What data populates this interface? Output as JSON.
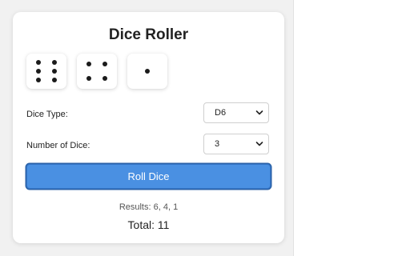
{
  "app": {
    "title": "Dice Roller"
  },
  "dice": [
    {
      "value": 6
    },
    {
      "value": 4
    },
    {
      "value": 1
    }
  ],
  "settings": {
    "dice_type_label": "Dice Type:",
    "dice_type_value": "D6",
    "number_of_dice_label": "Number of Dice:",
    "number_of_dice_value": "3"
  },
  "actions": {
    "roll_label": "Roll Dice"
  },
  "output": {
    "results_text": "Results: 6, 4, 1",
    "total_text": "Total: 11"
  },
  "colors": {
    "accent": "#4a90e2"
  }
}
